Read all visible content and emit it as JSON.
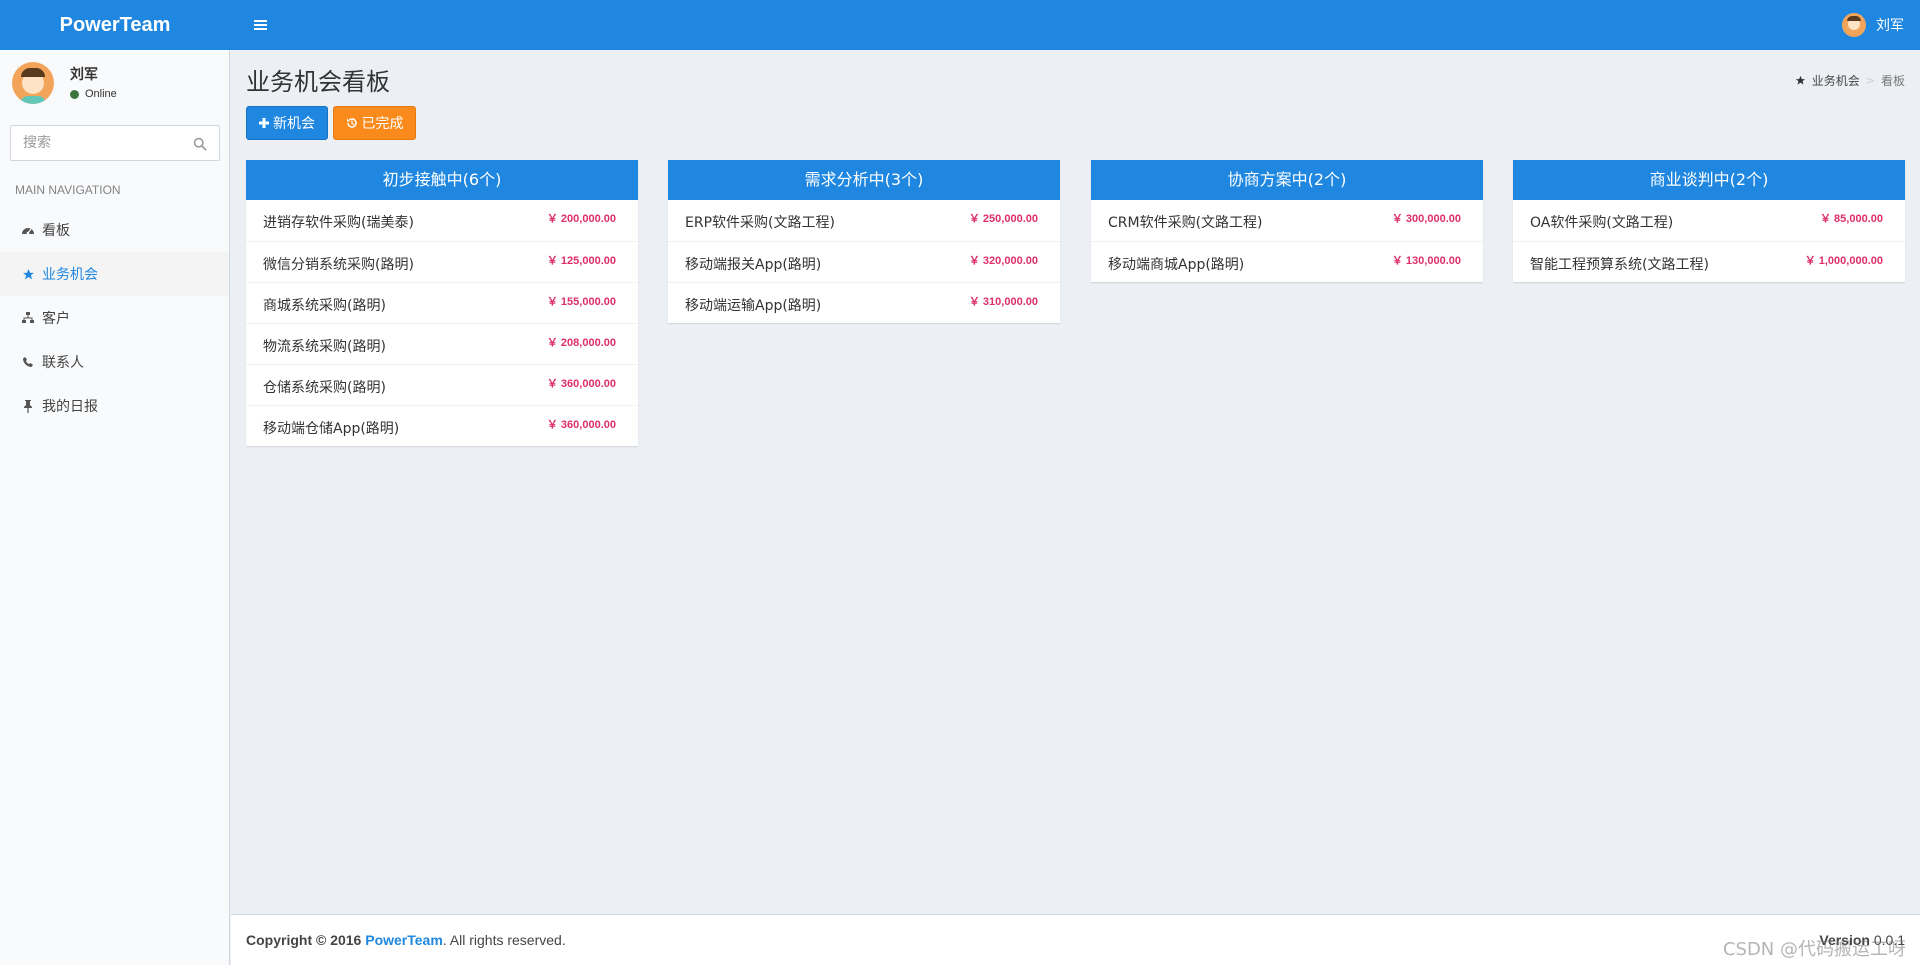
{
  "app": {
    "brand": "PowerTeam",
    "user_name": "刘军"
  },
  "sidebar": {
    "user": {
      "name": "刘军",
      "status": "Online"
    },
    "search": {
      "placeholder": "搜索"
    },
    "nav_header": "MAIN NAVIGATION",
    "items": [
      {
        "label": "看板",
        "icon": "dashboard-icon",
        "active": false
      },
      {
        "label": "业务机会",
        "icon": "star-icon",
        "active": true
      },
      {
        "label": "客户",
        "icon": "sitemap-icon",
        "active": false
      },
      {
        "label": "联系人",
        "icon": "phone-icon",
        "active": false
      },
      {
        "label": "我的日报",
        "icon": "pin-icon",
        "active": false
      }
    ]
  },
  "page": {
    "title": "业务机会看板",
    "breadcrumb": [
      {
        "label": "业务机会",
        "icon": "star-icon"
      },
      {
        "label": "看板"
      }
    ],
    "buttons": {
      "new": "新机会",
      "done": "已完成"
    }
  },
  "board": {
    "columns": [
      {
        "title": "初步接触中(6个)",
        "cards": [
          {
            "name": "进销存软件采购(瑞美泰)",
            "amount": "￥ 200,000.00"
          },
          {
            "name": "微信分销系统采购(路明)",
            "amount": "￥ 125,000.00"
          },
          {
            "name": "商城系统采购(路明)",
            "amount": "￥ 155,000.00"
          },
          {
            "name": "物流系统采购(路明)",
            "amount": "￥ 208,000.00"
          },
          {
            "name": "仓储系统采购(路明)",
            "amount": "￥ 360,000.00"
          },
          {
            "name": "移动端仓储App(路明)",
            "amount": "￥ 360,000.00"
          }
        ]
      },
      {
        "title": "需求分析中(3个)",
        "cards": [
          {
            "name": "ERP软件采购(文路工程)",
            "amount": "￥ 250,000.00"
          },
          {
            "name": "移动端报关App(路明)",
            "amount": "￥ 320,000.00"
          },
          {
            "name": "移动端运输App(路明)",
            "amount": "￥ 310,000.00"
          }
        ]
      },
      {
        "title": "协商方案中(2个)",
        "cards": [
          {
            "name": "CRM软件采购(文路工程)",
            "amount": "￥ 300,000.00"
          },
          {
            "name": "移动端商城App(路明)",
            "amount": "￥ 130,000.00"
          }
        ]
      },
      {
        "title": "商业谈判中(2个)",
        "cards": [
          {
            "name": "OA软件采购(文路工程)",
            "amount": "￥ 85,000.00"
          },
          {
            "name": "智能工程预算系统(文路工程)",
            "amount": "￥ 1,000,000.00"
          }
        ]
      }
    ]
  },
  "footer": {
    "copyright": "Copyright © 2016",
    "brand_link": "PowerTeam",
    "rights": ". All rights reserved.",
    "version_label": "Version",
    "version": "0.0.1"
  },
  "watermark": "CSDN @代码搬运工呀",
  "colors": {
    "primary": "#1f87e0",
    "warning": "#f98a1b",
    "amount": "#dd2e6b",
    "background": "#ecf0f5"
  }
}
